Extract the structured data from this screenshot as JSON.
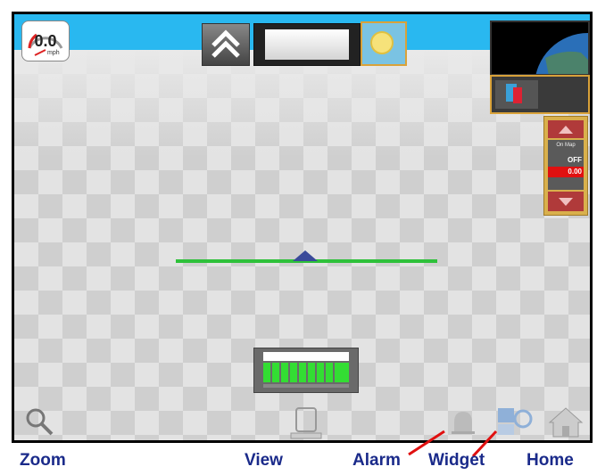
{
  "speedometer": {
    "value": "0.0",
    "unit": "mph"
  },
  "control_panel": {
    "label": "On Map",
    "state": "OFF",
    "rate": "0.00"
  },
  "labels": {
    "zoom": "Zoom",
    "view": "View",
    "alarm": "Alarm",
    "widget": "Widget",
    "home": "Home"
  },
  "colors": {
    "sky": "#29b8f0",
    "boom": "#2ec13a",
    "label_text": "#1a2a8a",
    "callout_line": "#e01010",
    "highlight_border": "#d9a23a"
  },
  "icons": {
    "speedometer": "speedometer-icon",
    "nav_up": "chevron-up-icon",
    "lightbar": "lightbar-icon",
    "sun": "sun-icon",
    "minimap": "globe-icon",
    "minimap_button": "map-toggle-icon",
    "zoom": "magnifier-icon",
    "view": "view-icon",
    "alarm": "bell-icon",
    "widget": "widget-icon",
    "home": "home-icon"
  }
}
